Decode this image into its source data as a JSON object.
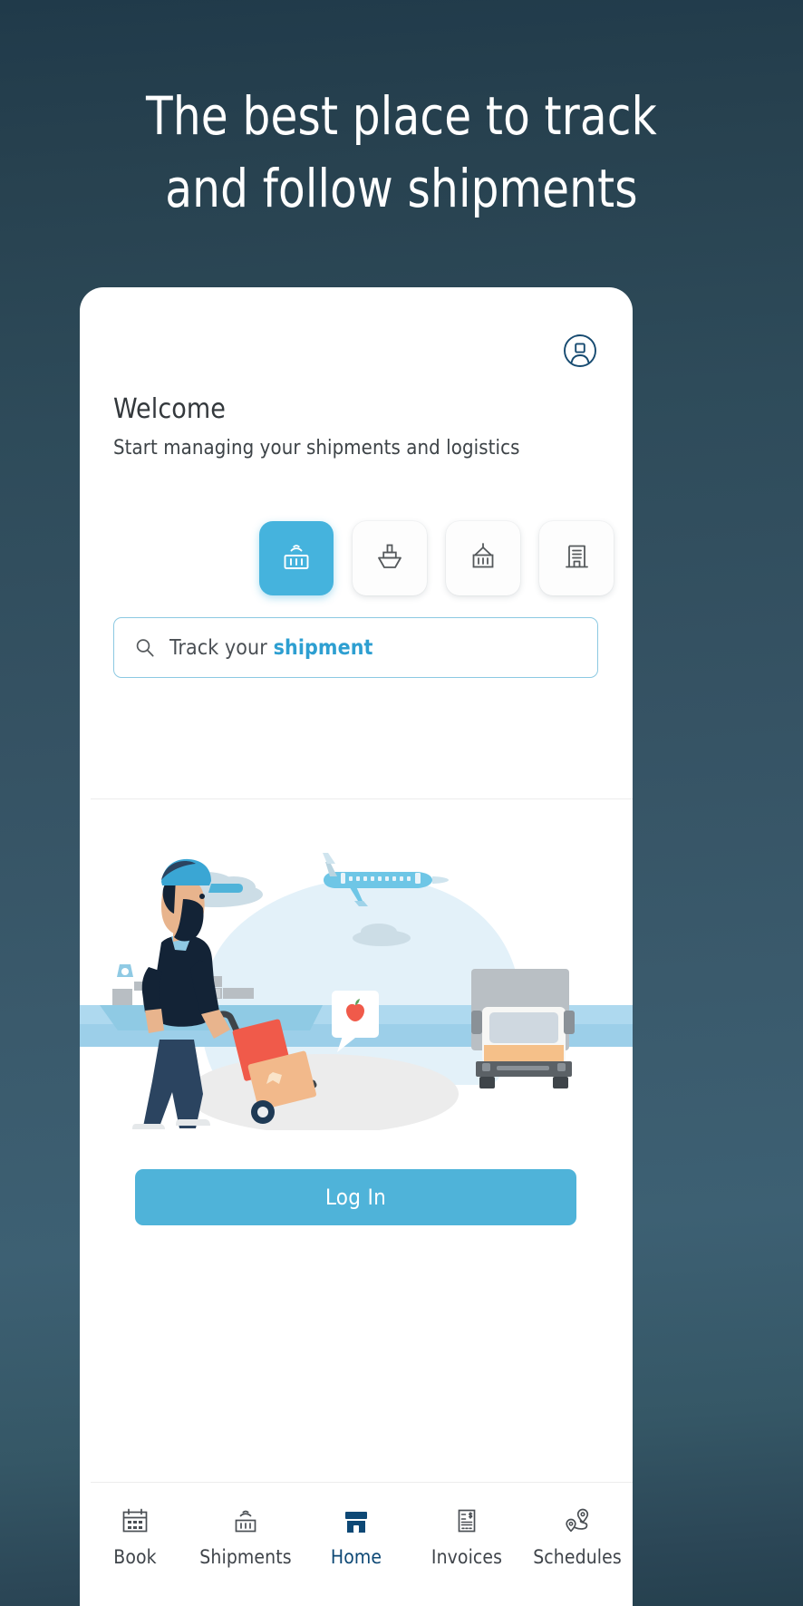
{
  "hero": {
    "line1": "The best place to track",
    "line2": "and follow shipments"
  },
  "card": {
    "account_icon": "account-circle-icon",
    "welcome_title": "Welcome",
    "welcome_subtitle": "Start managing your shipments and logistics",
    "categories": [
      {
        "name": "tracking",
        "icon": "container-tracking-icon",
        "selected": true
      },
      {
        "name": "ocean",
        "icon": "ship-icon",
        "selected": false
      },
      {
        "name": "container",
        "icon": "hanging-container-icon",
        "selected": false
      },
      {
        "name": "office",
        "icon": "office-building-icon",
        "selected": false
      }
    ],
    "search": {
      "icon": "search-icon",
      "prefix": "Track your ",
      "keyword": "shipment",
      "placeholder": "Track your shipment"
    },
    "illustration": {
      "name": "logistics-worker-illustration",
      "alt": "Worker with hand truck, cargo ship, airplane and delivery truck"
    },
    "login_label": "Log In"
  },
  "bottom_nav": [
    {
      "label": "Book",
      "icon": "calendar-icon",
      "active": false
    },
    {
      "label": "Shipments",
      "icon": "container-tracking-icon",
      "active": false
    },
    {
      "label": "Home",
      "icon": "home-store-icon",
      "active": true
    },
    {
      "label": "Invoices",
      "icon": "invoice-dollar-icon",
      "active": false
    },
    {
      "label": "Schedules",
      "icon": "route-pins-icon",
      "active": false
    }
  ],
  "colors": {
    "background_top": "#203a4a",
    "background_bottom": "#25404e",
    "accent_blue": "#4fb3d9",
    "link_blue": "#2e9fd1",
    "active_nav": "#0d4875",
    "card_bg": "#ffffff",
    "text_dark": "#33383c"
  }
}
